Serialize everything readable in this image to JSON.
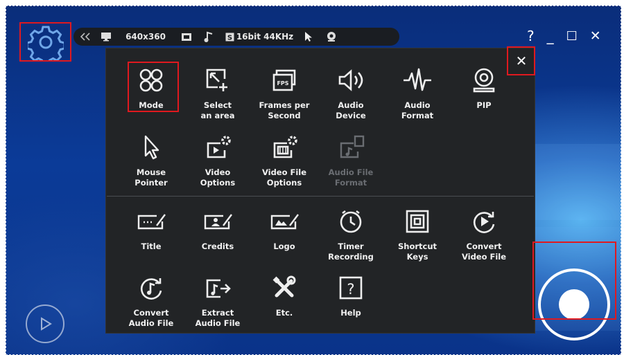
{
  "toolbar": {
    "collapse_icon": "double-chevron-left-icon",
    "monitor_icon": "monitor-icon",
    "resolution": "640x360",
    "fps_icon": "fps-icon",
    "audio_icon": "music-note-icon",
    "audio_format": "16bit 44KHz",
    "cursor_icon": "cursor-icon",
    "webcam_icon": "webcam-icon"
  },
  "window": {
    "help": "?",
    "minimize": "_",
    "maximize": "☐",
    "close": "✕"
  },
  "panel": {
    "close": "✕",
    "row1": [
      {
        "label": "Mode",
        "icon": "mode-icon"
      },
      {
        "label": "Select\nan area",
        "icon": "select-area-icon"
      },
      {
        "label": "Frames per\nSecond",
        "icon": "fps-icon"
      },
      {
        "label": "Audio\nDevice",
        "icon": "speaker-icon"
      },
      {
        "label": "Audio\nFormat",
        "icon": "waveform-icon"
      },
      {
        "label": "PIP",
        "icon": "webcam-icon"
      }
    ],
    "row2": [
      {
        "label": "Mouse\nPointer",
        "icon": "cursor-icon"
      },
      {
        "label": "Video\nOptions",
        "icon": "video-options-icon"
      },
      {
        "label": "Video File\nOptions",
        "icon": "video-file-options-icon"
      },
      {
        "label": "Audio File\nFormat",
        "icon": "audio-file-format-icon",
        "disabled": true
      }
    ],
    "row3": [
      {
        "label": "Title",
        "icon": "title-icon"
      },
      {
        "label": "Credits",
        "icon": "credits-icon"
      },
      {
        "label": "Logo",
        "icon": "logo-icon"
      },
      {
        "label": "Timer\nRecording",
        "icon": "timer-icon"
      },
      {
        "label": "Shortcut\nKeys",
        "icon": "shortcut-keys-icon"
      },
      {
        "label": "Convert\nVideo File",
        "icon": "convert-video-icon"
      }
    ],
    "row4": [
      {
        "label": "Convert\nAudio File",
        "icon": "convert-audio-icon"
      },
      {
        "label": "Extract\nAudio File",
        "icon": "extract-audio-icon"
      },
      {
        "label": "Etc.",
        "icon": "tools-icon"
      },
      {
        "label": "Help",
        "icon": "help-icon"
      }
    ]
  },
  "colors": {
    "panel_bg": "#222426",
    "highlight": "#e0191f",
    "desktop": "#0b3b98"
  }
}
